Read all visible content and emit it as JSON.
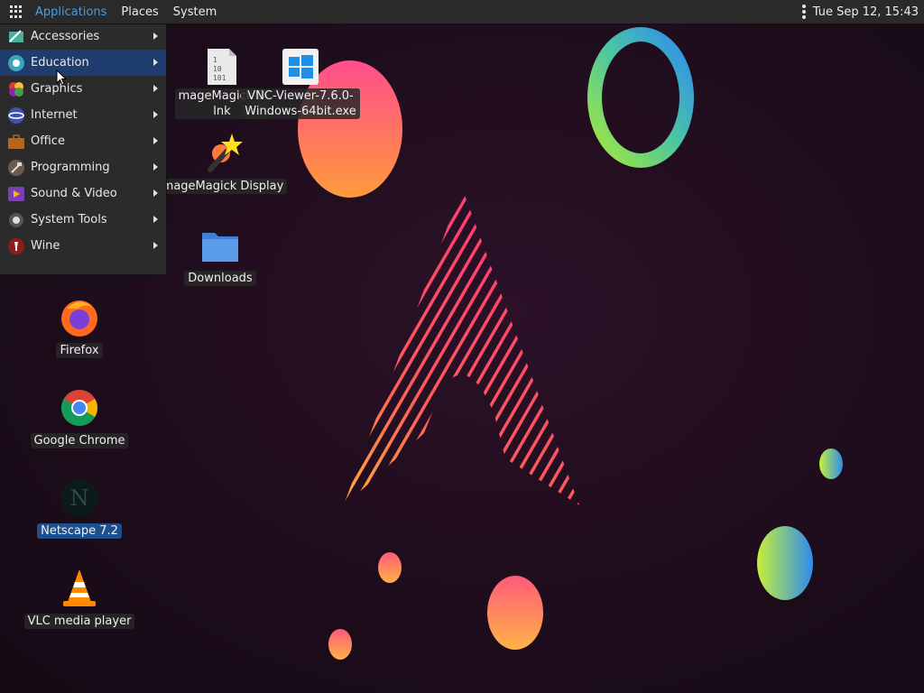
{
  "top_panel": {
    "applications": "Applications",
    "places": "Places",
    "system": "System",
    "clock": "Tue Sep 12, 15:43"
  },
  "app_menu": {
    "items": [
      {
        "label": "Accessories",
        "icon": "accessories-icon"
      },
      {
        "label": "Education",
        "icon": "education-icon",
        "selected": true
      },
      {
        "label": "Graphics",
        "icon": "graphics-icon"
      },
      {
        "label": "Internet",
        "icon": "internet-icon"
      },
      {
        "label": "Office",
        "icon": "office-icon"
      },
      {
        "label": "Programming",
        "icon": "programming-icon"
      },
      {
        "label": "Sound & Video",
        "icon": "sound-video-icon"
      },
      {
        "label": "System Tools",
        "icon": "system-tools-icon"
      },
      {
        "label": "Wine",
        "icon": "wine-icon"
      }
    ]
  },
  "desktop_icons": {
    "imagemagick_lnk": {
      "line1": "mageMagick D",
      "line2": "lnk"
    },
    "vnc_viewer": {
      "line1": "VNC-Viewer-7.6.0-",
      "line2": "Windows-64bit.exe"
    },
    "imagemagick_display": {
      "label": "mageMagick Display"
    },
    "downloads": {
      "label": "Downloads"
    },
    "firefox": {
      "label": "Firefox"
    },
    "chrome": {
      "label": "Google Chrome"
    },
    "netscape": {
      "label": "Netscape 7.2",
      "selected": true
    },
    "vlc": {
      "label": "VLC media player"
    }
  },
  "colors": {
    "accent": "#4d9be0",
    "menu_selected": "#1e3d6e",
    "panel_bg": "#2a2a2a"
  }
}
